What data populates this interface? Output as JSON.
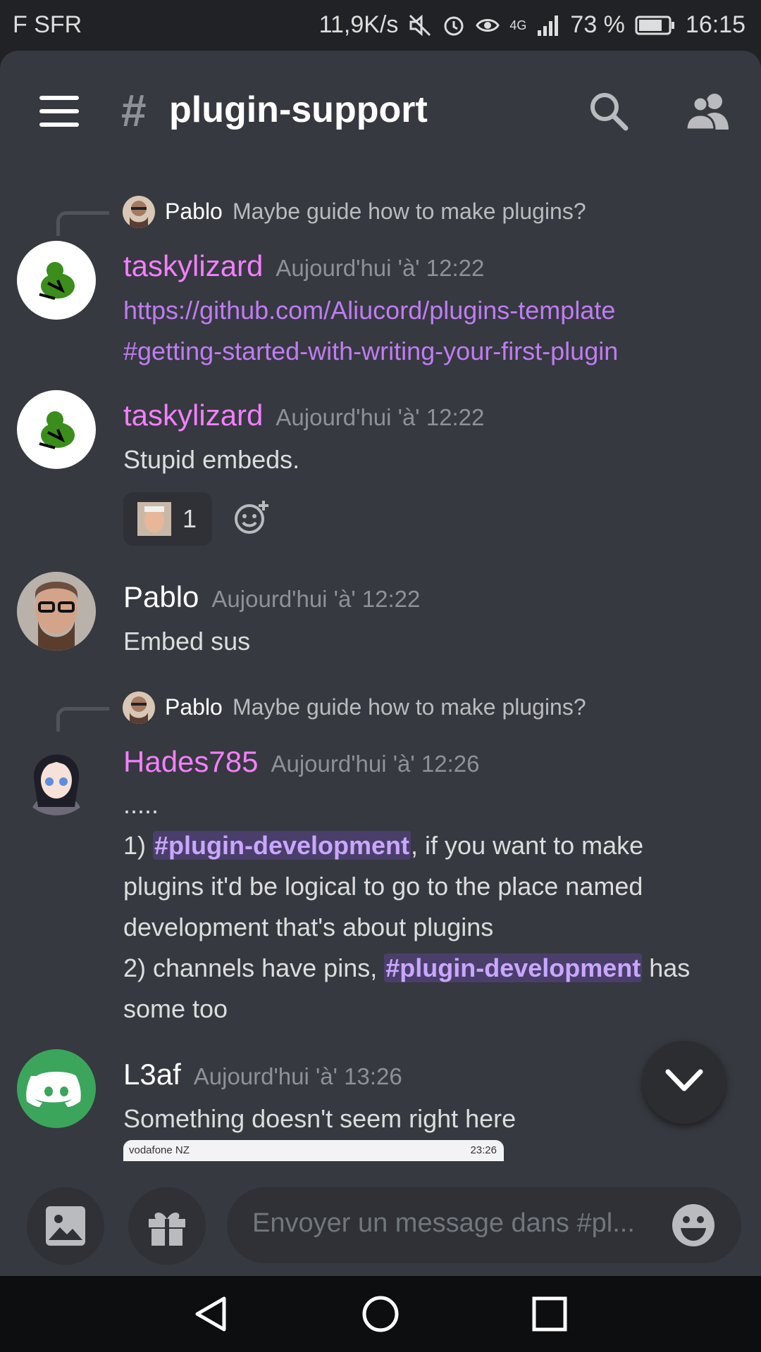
{
  "status_bar": {
    "carrier": "F SFR",
    "speed": "11,9K/s",
    "network": "4G",
    "battery": "73 %",
    "time": "16:15"
  },
  "header": {
    "channel_name": "plugin-support",
    "hash": "#"
  },
  "messages": [
    {
      "reply": {
        "name": "Pablo",
        "text": "Maybe guide how to make plugins?"
      },
      "author": "taskylizard",
      "author_color": "#f47fff",
      "timestamp": "Aujourd'hui 'à' 12:22",
      "lines": [
        "https://github.com/Aliucord/plugins-template",
        "#getting-started-with-writing-your-first-plugin"
      ]
    },
    {
      "author": "taskylizard",
      "author_color": "#f47fff",
      "timestamp": "Aujourd'hui 'à' 12:22",
      "text": "Stupid embeds.",
      "reaction_count": "1"
    },
    {
      "author": "Pablo",
      "author_color": "#ffffff",
      "timestamp": "Aujourd'hui 'à' 12:22",
      "text": "Embed sus"
    },
    {
      "reply": {
        "name": "Pablo",
        "text": "Maybe guide how to make plugins?"
      },
      "author": "Hades785",
      "author_color": "#f47fff",
      "timestamp": "Aujourd'hui 'à' 12:26",
      "line1": ".....",
      "p1_a": "1) ",
      "mention": "#plugin-development",
      "p1_b": ", if you want to make",
      "line3": "plugins it'd be logical to go to the place named",
      "line4": "development that's about plugins",
      "p2_a": "2) channels have pins, ",
      "p2_b": " has",
      "line6": "some too"
    },
    {
      "author": "L3af",
      "author_color": "#ffffff",
      "timestamp": "Aujourd'hui 'à' 13:26",
      "text": "Something doesn't seem right here",
      "attachment_left": "vodafone NZ",
      "attachment_right": "23:26"
    }
  ],
  "input": {
    "placeholder": "Envoyer un message dans #pl..."
  },
  "colors": {
    "background": "#36393f",
    "accent_link": "#c07cf5",
    "mention_bg": "#4a3f6a",
    "discord_green": "#3ba55c"
  },
  "icons": [
    "hamburger-icon",
    "search-icon",
    "members-icon",
    "add-reaction-icon",
    "chevron-down-icon",
    "image-icon",
    "gift-icon",
    "emoji-icon",
    "back-icon",
    "home-icon",
    "recents-icon"
  ]
}
